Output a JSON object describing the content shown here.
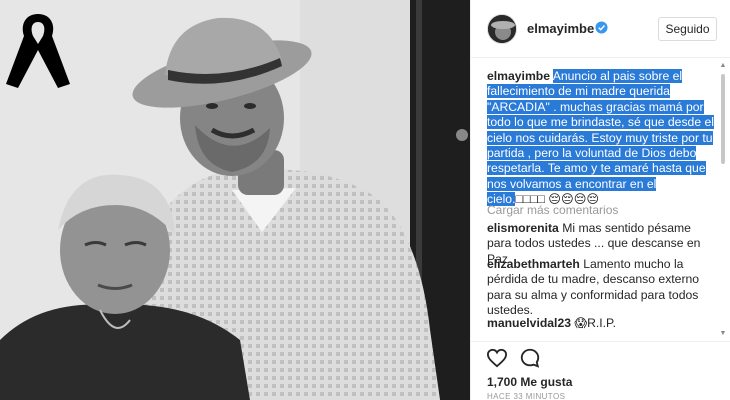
{
  "post": {
    "username": "elmayimbe",
    "follow_label": "Seguido",
    "caption_user": "elmayimbe",
    "caption_text": "Anuncio al pais sobre el fallecimiento de mi madre querida \"ARCADIA\" . muchas gracias mamá por todo lo que me brindaste, sé que desde el cielo nos cuidarás. Estoy muy triste por tu partida , pero la voluntad de Dios debo respetarla. Te amo y te amaré hasta que nos volvamos a encontrar en el cielo.",
    "caption_trailing": "□□□□ 😔😔😔😔",
    "load_more": "Cargar más comentarios",
    "likes": "1,700 Me gusta",
    "timestamp": "HACE 33 MINUTOS"
  },
  "comments": [
    {
      "user": "elismorenita",
      "text": "Mi mas sentido pésame para todos ustedes ... que descanse en Paz"
    },
    {
      "user": "elizabethmarteh",
      "text": "Lamento mucho la pérdida de tu madre, descanso externo para su alma y conformidad para todos ustedes."
    },
    {
      "user": "manuelvidal23",
      "text": "😱R.I.P."
    }
  ],
  "icons": {
    "verified": "verified-badge-icon",
    "ribbon": "mourning-ribbon-icon",
    "like": "heart-icon",
    "comment": "comment-bubble-icon"
  },
  "colors": {
    "highlight": "#2a7ad8",
    "verified": "#3897f0",
    "muted": "#999999"
  }
}
